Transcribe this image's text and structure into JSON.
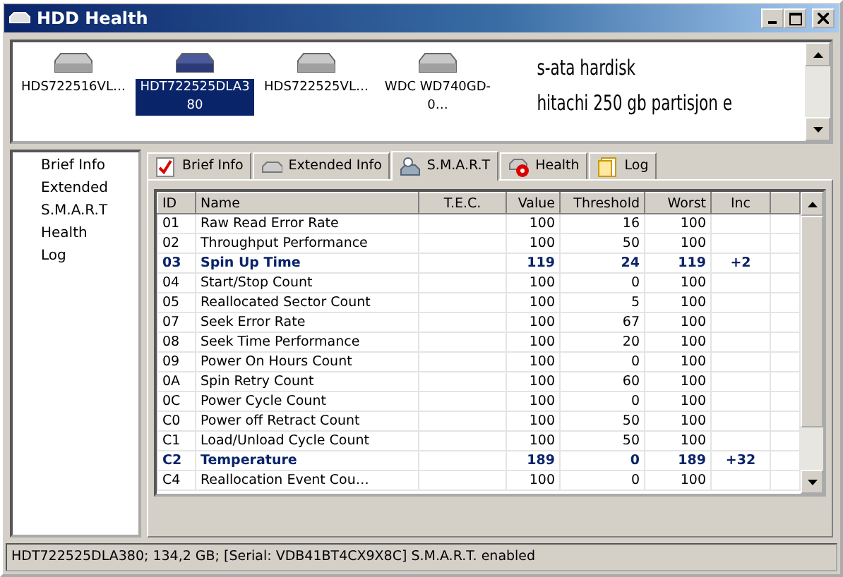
{
  "window": {
    "title": "HDD Health"
  },
  "drives": [
    {
      "label": "HDS722516VL…",
      "selected": false
    },
    {
      "label": "HDT722525DLA3 80",
      "selected": true
    },
    {
      "label": "HDS722525VL…",
      "selected": false
    },
    {
      "label": "WDC WD740GD-0…",
      "selected": false
    }
  ],
  "drive_notes": [
    "s-ata hardisk",
    "hitachi 250 gb partisjon e"
  ],
  "sidebar": {
    "items": [
      "Brief Info",
      "Extended",
      "S.M.A.R.T",
      "Health",
      "Log"
    ]
  },
  "tabs": [
    {
      "label": "Brief Info",
      "selected": false
    },
    {
      "label": "Extended Info",
      "selected": false
    },
    {
      "label": "S.M.A.R.T",
      "selected": true
    },
    {
      "label": "Health",
      "selected": false
    },
    {
      "label": "Log",
      "selected": false
    }
  ],
  "table": {
    "columns": [
      "ID",
      "Name",
      "T.E.C.",
      "Value",
      "Threshold",
      "Worst",
      "Inc"
    ],
    "rows": [
      {
        "cells": [
          "01",
          "Raw Read Error Rate",
          "",
          "100",
          "16",
          "100",
          ""
        ],
        "highlight": false
      },
      {
        "cells": [
          "02",
          "Throughput Performance",
          "",
          "100",
          "50",
          "100",
          ""
        ],
        "highlight": false
      },
      {
        "cells": [
          "03",
          "Spin Up Time",
          "",
          "119",
          "24",
          "119",
          "+2"
        ],
        "highlight": true
      },
      {
        "cells": [
          "04",
          "Start/Stop Count",
          "",
          "100",
          "0",
          "100",
          ""
        ],
        "highlight": false
      },
      {
        "cells": [
          "05",
          "Reallocated Sector Count",
          "",
          "100",
          "5",
          "100",
          ""
        ],
        "highlight": false
      },
      {
        "cells": [
          "07",
          "Seek Error Rate",
          "",
          "100",
          "67",
          "100",
          ""
        ],
        "highlight": false
      },
      {
        "cells": [
          "08",
          "Seek Time Performance",
          "",
          "100",
          "20",
          "100",
          ""
        ],
        "highlight": false
      },
      {
        "cells": [
          "09",
          "Power On Hours Count",
          "",
          "100",
          "0",
          "100",
          ""
        ],
        "highlight": false
      },
      {
        "cells": [
          "0A",
          "Spin Retry Count",
          "",
          "100",
          "60",
          "100",
          ""
        ],
        "highlight": false
      },
      {
        "cells": [
          "0C",
          "Power Cycle Count",
          "",
          "100",
          "0",
          "100",
          ""
        ],
        "highlight": false
      },
      {
        "cells": [
          "C0",
          "Power off Retract Count",
          "",
          "100",
          "50",
          "100",
          ""
        ],
        "highlight": false
      },
      {
        "cells": [
          "C1",
          "Load/Unload Cycle Count",
          "",
          "100",
          "50",
          "100",
          ""
        ],
        "highlight": false
      },
      {
        "cells": [
          "C2",
          "Temperature",
          "",
          "189",
          "0",
          "189",
          "+32"
        ],
        "highlight": true
      },
      {
        "cells": [
          "C4",
          "Reallocation Event Cou…",
          "",
          "100",
          "0",
          "100",
          ""
        ],
        "highlight": false
      }
    ]
  },
  "status_bar": "HDT722525DLA380;  134,2 GB;  [Serial: VDB41BT4CX9X8C]   S.M.A.R.T. enabled"
}
